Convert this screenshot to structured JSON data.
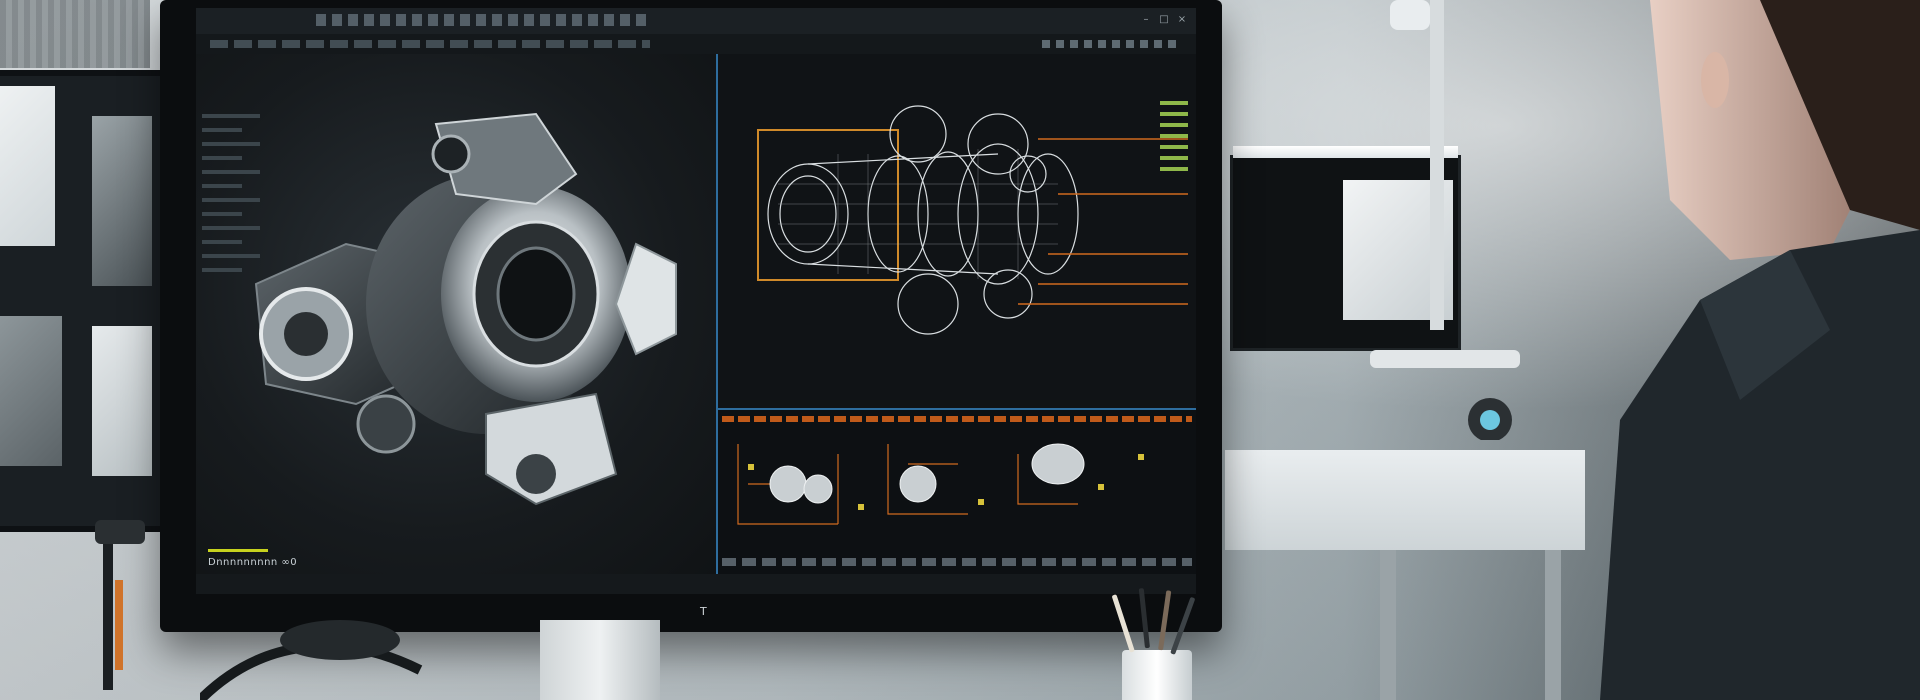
{
  "scene": {
    "description_tags": [
      "cad-workstation",
      "engineer",
      "monitor"
    ]
  },
  "cad_app": {
    "title_bar_text": "",
    "status_text": "Dnnnnnnnnn ∞0",
    "monitor_badge": "T"
  },
  "colors": {
    "accent_blue": "#2e6d9e",
    "wire_orange": "#d06a1f",
    "status_green": "#8fb84a",
    "highlight_yellow": "#c7d21e"
  }
}
